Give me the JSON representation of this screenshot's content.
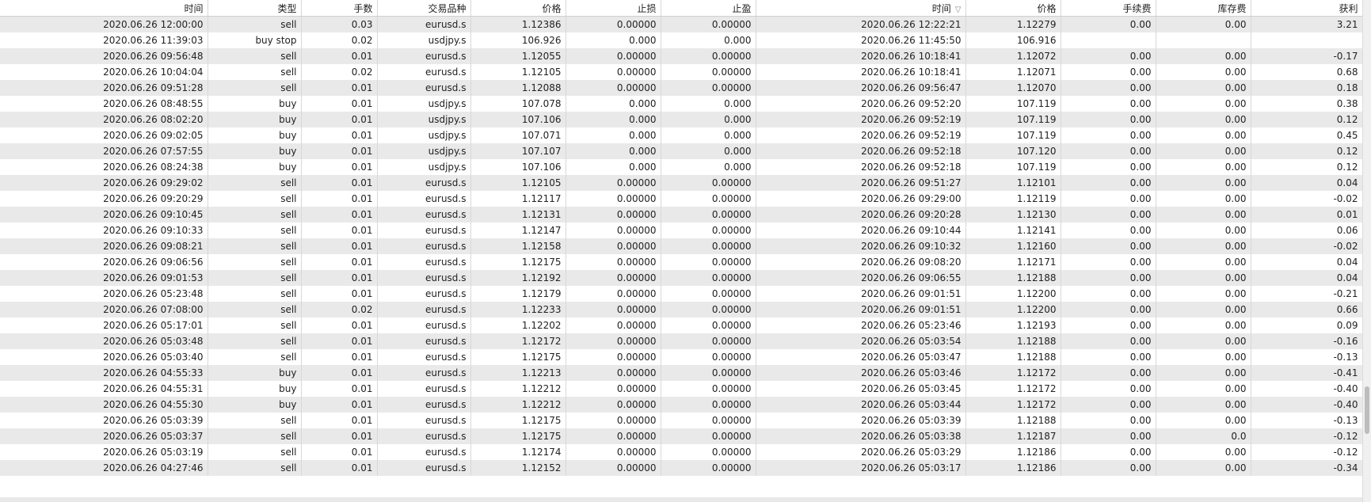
{
  "columns": [
    "时间",
    "类型",
    "手数",
    "交易品种",
    "价格",
    "止损",
    "止盈",
    "时间",
    "价格",
    "手续费",
    "库存费",
    "获利"
  ],
  "sort_icon": "▽",
  "rows": [
    [
      "2020.06.26 12:00:00",
      "sell",
      "0.03",
      "eurusd.s",
      "1.12386",
      "0.00000",
      "0.00000",
      "2020.06.26 12:22:21",
      "1.12279",
      "0.00",
      "0.00",
      "3.21"
    ],
    [
      "2020.06.26 11:39:03",
      "buy stop",
      "0.02",
      "usdjpy.s",
      "106.926",
      "0.000",
      "0.000",
      "2020.06.26 11:45:50",
      "106.916",
      "",
      "",
      ""
    ],
    [
      "2020.06.26 09:56:48",
      "sell",
      "0.01",
      "eurusd.s",
      "1.12055",
      "0.00000",
      "0.00000",
      "2020.06.26 10:18:41",
      "1.12072",
      "0.00",
      "0.00",
      "-0.17"
    ],
    [
      "2020.06.26 10:04:04",
      "sell",
      "0.02",
      "eurusd.s",
      "1.12105",
      "0.00000",
      "0.00000",
      "2020.06.26 10:18:41",
      "1.12071",
      "0.00",
      "0.00",
      "0.68"
    ],
    [
      "2020.06.26 09:51:28",
      "sell",
      "0.01",
      "eurusd.s",
      "1.12088",
      "0.00000",
      "0.00000",
      "2020.06.26 09:56:47",
      "1.12070",
      "0.00",
      "0.00",
      "0.18"
    ],
    [
      "2020.06.26 08:48:55",
      "buy",
      "0.01",
      "usdjpy.s",
      "107.078",
      "0.000",
      "0.000",
      "2020.06.26 09:52:20",
      "107.119",
      "0.00",
      "0.00",
      "0.38"
    ],
    [
      "2020.06.26 08:02:20",
      "buy",
      "0.01",
      "usdjpy.s",
      "107.106",
      "0.000",
      "0.000",
      "2020.06.26 09:52:19",
      "107.119",
      "0.00",
      "0.00",
      "0.12"
    ],
    [
      "2020.06.26 09:02:05",
      "buy",
      "0.01",
      "usdjpy.s",
      "107.071",
      "0.000",
      "0.000",
      "2020.06.26 09:52:19",
      "107.119",
      "0.00",
      "0.00",
      "0.45"
    ],
    [
      "2020.06.26 07:57:55",
      "buy",
      "0.01",
      "usdjpy.s",
      "107.107",
      "0.000",
      "0.000",
      "2020.06.26 09:52:18",
      "107.120",
      "0.00",
      "0.00",
      "0.12"
    ],
    [
      "2020.06.26 08:24:38",
      "buy",
      "0.01",
      "usdjpy.s",
      "107.106",
      "0.000",
      "0.000",
      "2020.06.26 09:52:18",
      "107.119",
      "0.00",
      "0.00",
      "0.12"
    ],
    [
      "2020.06.26 09:29:02",
      "sell",
      "0.01",
      "eurusd.s",
      "1.12105",
      "0.00000",
      "0.00000",
      "2020.06.26 09:51:27",
      "1.12101",
      "0.00",
      "0.00",
      "0.04"
    ],
    [
      "2020.06.26 09:20:29",
      "sell",
      "0.01",
      "eurusd.s",
      "1.12117",
      "0.00000",
      "0.00000",
      "2020.06.26 09:29:00",
      "1.12119",
      "0.00",
      "0.00",
      "-0.02"
    ],
    [
      "2020.06.26 09:10:45",
      "sell",
      "0.01",
      "eurusd.s",
      "1.12131",
      "0.00000",
      "0.00000",
      "2020.06.26 09:20:28",
      "1.12130",
      "0.00",
      "0.00",
      "0.01"
    ],
    [
      "2020.06.26 09:10:33",
      "sell",
      "0.01",
      "eurusd.s",
      "1.12147",
      "0.00000",
      "0.00000",
      "2020.06.26 09:10:44",
      "1.12141",
      "0.00",
      "0.00",
      "0.06"
    ],
    [
      "2020.06.26 09:08:21",
      "sell",
      "0.01",
      "eurusd.s",
      "1.12158",
      "0.00000",
      "0.00000",
      "2020.06.26 09:10:32",
      "1.12160",
      "0.00",
      "0.00",
      "-0.02"
    ],
    [
      "2020.06.26 09:06:56",
      "sell",
      "0.01",
      "eurusd.s",
      "1.12175",
      "0.00000",
      "0.00000",
      "2020.06.26 09:08:20",
      "1.12171",
      "0.00",
      "0.00",
      "0.04"
    ],
    [
      "2020.06.26 09:01:53",
      "sell",
      "0.01",
      "eurusd.s",
      "1.12192",
      "0.00000",
      "0.00000",
      "2020.06.26 09:06:55",
      "1.12188",
      "0.00",
      "0.00",
      "0.04"
    ],
    [
      "2020.06.26 05:23:48",
      "sell",
      "0.01",
      "eurusd.s",
      "1.12179",
      "0.00000",
      "0.00000",
      "2020.06.26 09:01:51",
      "1.12200",
      "0.00",
      "0.00",
      "-0.21"
    ],
    [
      "2020.06.26 07:08:00",
      "sell",
      "0.02",
      "eurusd.s",
      "1.12233",
      "0.00000",
      "0.00000",
      "2020.06.26 09:01:51",
      "1.12200",
      "0.00",
      "0.00",
      "0.66"
    ],
    [
      "2020.06.26 05:17:01",
      "sell",
      "0.01",
      "eurusd.s",
      "1.12202",
      "0.00000",
      "0.00000",
      "2020.06.26 05:23:46",
      "1.12193",
      "0.00",
      "0.00",
      "0.09"
    ],
    [
      "2020.06.26 05:03:48",
      "sell",
      "0.01",
      "eurusd.s",
      "1.12172",
      "0.00000",
      "0.00000",
      "2020.06.26 05:03:54",
      "1.12188",
      "0.00",
      "0.00",
      "-0.16"
    ],
    [
      "2020.06.26 05:03:40",
      "sell",
      "0.01",
      "eurusd.s",
      "1.12175",
      "0.00000",
      "0.00000",
      "2020.06.26 05:03:47",
      "1.12188",
      "0.00",
      "0.00",
      "-0.13"
    ],
    [
      "2020.06.26 04:55:33",
      "buy",
      "0.01",
      "eurusd.s",
      "1.12213",
      "0.00000",
      "0.00000",
      "2020.06.26 05:03:46",
      "1.12172",
      "0.00",
      "0.00",
      "-0.41"
    ],
    [
      "2020.06.26 04:55:31",
      "buy",
      "0.01",
      "eurusd.s",
      "1.12212",
      "0.00000",
      "0.00000",
      "2020.06.26 05:03:45",
      "1.12172",
      "0.00",
      "0.00",
      "-0.40"
    ],
    [
      "2020.06.26 04:55:30",
      "buy",
      "0.01",
      "eurusd.s",
      "1.12212",
      "0.00000",
      "0.00000",
      "2020.06.26 05:03:44",
      "1.12172",
      "0.00",
      "0.00",
      "-0.40"
    ],
    [
      "2020.06.26 05:03:39",
      "sell",
      "0.01",
      "eurusd.s",
      "1.12175",
      "0.00000",
      "0.00000",
      "2020.06.26 05:03:39",
      "1.12188",
      "0.00",
      "0.00",
      "-0.13"
    ],
    [
      "2020.06.26 05:03:37",
      "sell",
      "0.01",
      "eurusd.s",
      "1.12175",
      "0.00000",
      "0.00000",
      "2020.06.26 05:03:38",
      "1.12187",
      "0.00",
      "0.0",
      "-0.12"
    ],
    [
      "2020.06.26 05:03:19",
      "sell",
      "0.01",
      "eurusd.s",
      "1.12174",
      "0.00000",
      "0.00000",
      "2020.06.26 05:03:29",
      "1.12186",
      "0.00",
      "0.00",
      "-0.12"
    ],
    [
      "2020.06.26 04:27:46",
      "sell",
      "0.01",
      "eurusd.s",
      "1.12152",
      "0.00000",
      "0.00000",
      "2020.06.26 05:03:17",
      "1.12186",
      "0.00",
      "0.00",
      "-0.34"
    ]
  ]
}
